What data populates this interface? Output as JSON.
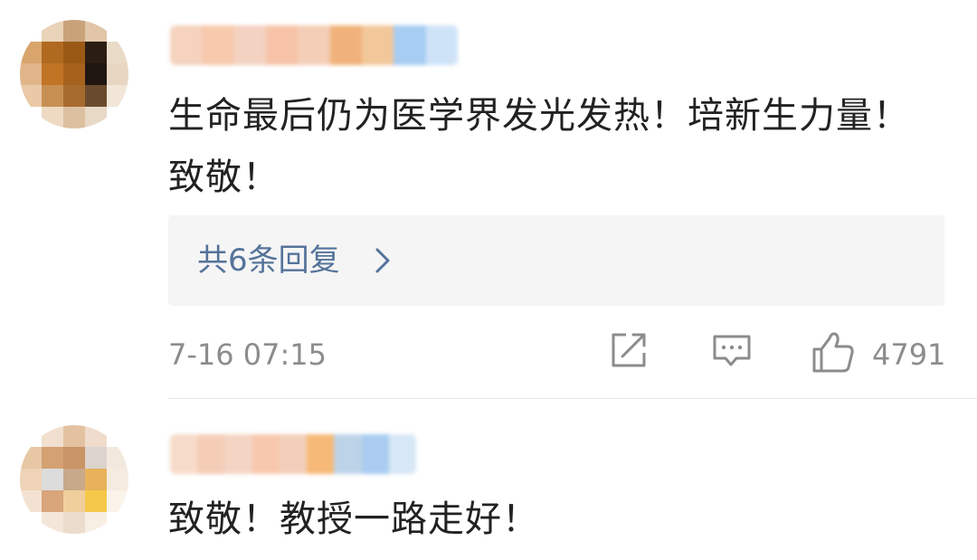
{
  "comments": [
    {
      "text": "生命最后仍为医学界发光发热！培新生力量！致敬！",
      "reply_link": "共6条回复",
      "time": "7-16 07:15",
      "likes": "4791",
      "avatar_colors": [
        "#ffffff",
        "#e9d3b9",
        "#c9a27a",
        "#e1c7a8",
        "#ffffff",
        "#d9a56d",
        "#b06a1f",
        "#9a5a16",
        "#2b1d12",
        "#eadbc8",
        "#e0b58a",
        "#c07424",
        "#a6611d",
        "#1f1611",
        "#e8d6c2",
        "#e9c9a6",
        "#c88f53",
        "#a76a2e",
        "#6a4a2c",
        "#f2e6d9",
        "#ffffff",
        "#eed9c2",
        "#dcc0a0",
        "#e8d8c6",
        "#ffffff"
      ],
      "name_colors": [
        "#f5d3bf",
        "#f7c9ad",
        "#f3d2c2",
        "#f6c3a8",
        "#f4ceb7",
        "#f0b27a",
        "#f2c79a",
        "#a7cdf2",
        "#cfe3f7"
      ]
    },
    {
      "text": "致敬！教授一路走好！",
      "avatar_colors": [
        "#ffffff",
        "#f1dfcf",
        "#e2c2a1",
        "#efdccc",
        "#ffffff",
        "#e8c7a5",
        "#d4a173",
        "#c99466",
        "#dcd3cd",
        "#f2e8de",
        "#eed3b8",
        "#dcdcdc",
        "#c8a98a",
        "#e7b259",
        "#f6ebdf",
        "#f3e2d2",
        "#d9a57a",
        "#f0cf9d",
        "#f6c84a",
        "#fbf4ea",
        "#ffffff",
        "#f4e6d8",
        "#ecdccc",
        "#f7eee4",
        "#ffffff"
      ],
      "name_colors": [
        "#f7dbc9",
        "#f5cdb7",
        "#f4d5c4",
        "#f7c8ad",
        "#f2cfba",
        "#f6b977",
        "#bcd3e8",
        "#a9ccf0",
        "#d7e7f6"
      ]
    }
  ],
  "icons": {
    "share": "share-icon",
    "comment": "comment-icon",
    "like": "thumbs-up-icon",
    "chevron": "chevron-right-icon"
  },
  "colors": {
    "text": "#222222",
    "meta": "#8c8c8c",
    "link": "#55739a",
    "reply_bg": "#f5f5f5",
    "divider": "#e6e6e6"
  }
}
